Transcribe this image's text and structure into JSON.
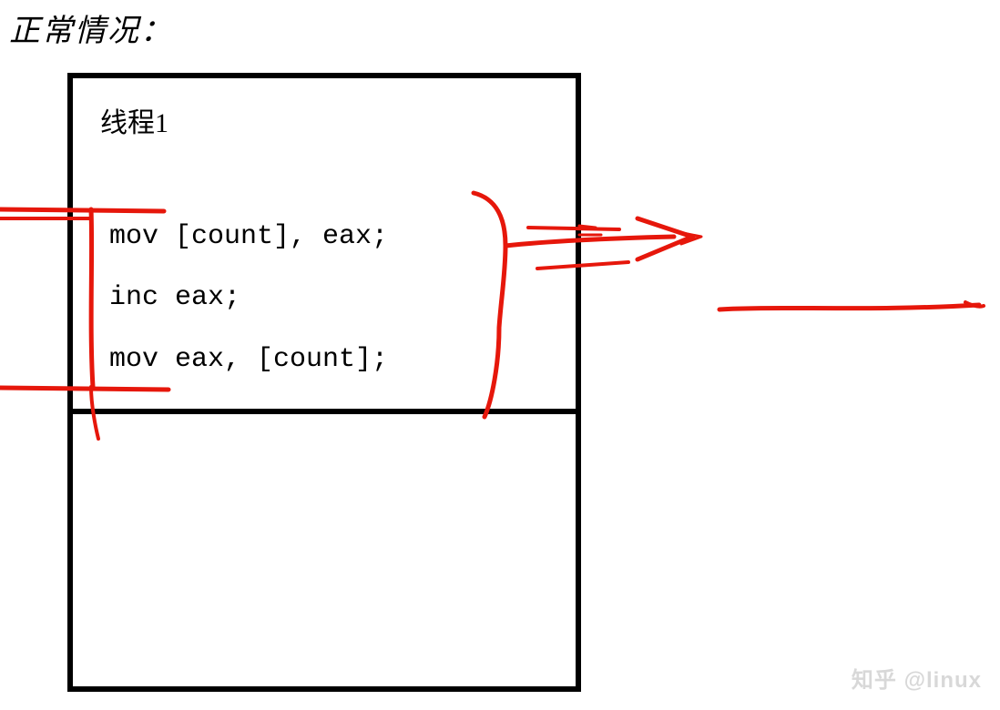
{
  "title": "正常情况：",
  "box_title": "线程1",
  "code": {
    "line1": "mov [count], eax;",
    "line2": "inc eax;",
    "line3": "mov eax, [count];"
  },
  "watermark": "知乎 @linux",
  "colors": {
    "annotation": "#e6170b",
    "border": "#000000"
  }
}
